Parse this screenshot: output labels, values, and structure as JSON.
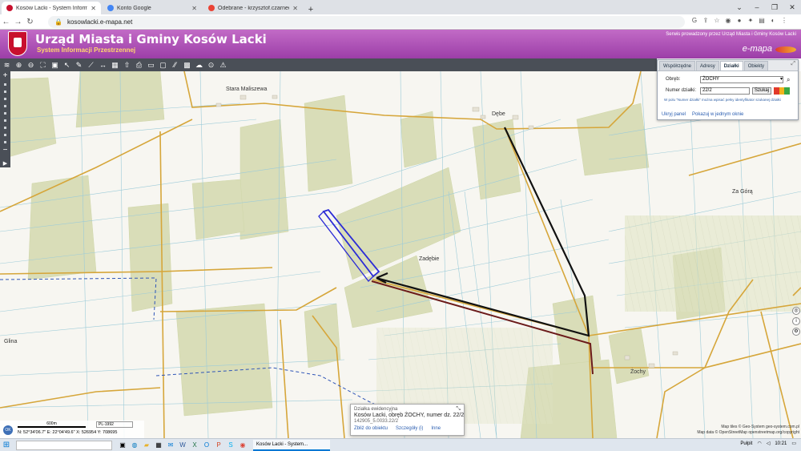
{
  "browser": {
    "tabs": [
      {
        "label": "Kosów Lacki - System Informacji",
        "color": "#c8102e"
      },
      {
        "label": "Konto Google",
        "color": "#4285f4"
      },
      {
        "label": "Odebrane - krzysztof.czarnecki@",
        "color": "#ea4335"
      }
    ],
    "new_tab": "+",
    "url": "kosowlacki.e-mapa.net"
  },
  "header": {
    "title": "Urząd Miasta i Gminy Kosów Lacki",
    "subtitle": "System Informacji Przestrzennej",
    "service_text": "Serwis prowadzony przez Urząd Miasta i Gminy Kosów Lacki",
    "brand": "e-mapa"
  },
  "panel": {
    "tabs": [
      "Współrzędne",
      "Adresy",
      "Działki",
      "Obiekty"
    ],
    "active_tab": "Działki",
    "obreb_label": "Obręb:",
    "obreb_value": "ŻOCHY",
    "numer_label": "Numer działki:",
    "numer_value": "22/2",
    "search_button": "Szukaj",
    "hint": "W polu \"Numer działki\" można wpisać pełny identyfikator szukanej działki",
    "link_hide": "Ukryj panel",
    "link_window": "Pokazuj w jednym oknie"
  },
  "map_labels": {
    "stara_maliszewa": "Stara Maliszewa",
    "debe": "Dębe",
    "za_gora": "Za Górą",
    "zadebie": "Zadębie",
    "zochy": "Żochy",
    "glina": "Glina"
  },
  "popup": {
    "title": "Działka ewidencyjna",
    "line": "Kosów Lacki, obręb ŻOCHY, numer dz. 22/2",
    "id": "142905_5.0033.22/2",
    "link_zoom": "Zbliż do obiektu",
    "link_details": "Szczegóły (i)",
    "link_other": "Inne"
  },
  "status": {
    "ok": "OK",
    "scale": "600m",
    "crs": "PL-1992",
    "coords": "N: 52°34'06.7\"  E: 22°04'49.6\"   X: 526954     Y: 708695"
  },
  "attribution": {
    "line1": "Map tiles © Geo-System geo-system.com.pl",
    "line2": "Map data © OpenStreetMap openstreetmap.org/copyright"
  },
  "taskbar": {
    "search_placeholder": "",
    "active_window": "Kosów Lacki - System...",
    "weather": "Pułpit",
    "time": "10:21"
  },
  "colors": {
    "header_purple": "#a447b0",
    "toolbar": "#4a4f57",
    "road": "#d6a63a",
    "parcel_outline": "#2b2bd6",
    "arrow_black": "#111111",
    "arrow_red": "#6b1a1a",
    "field_green": "#d9ddb8"
  }
}
